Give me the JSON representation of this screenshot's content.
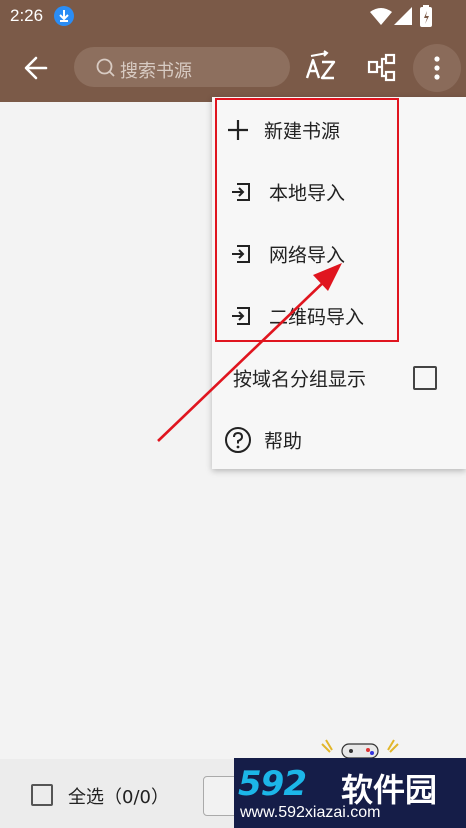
{
  "status_bar": {
    "time": "2:26"
  },
  "toolbar": {
    "search_placeholder": "搜索书源",
    "sort_label": "AZ"
  },
  "menu": {
    "items": [
      {
        "label": "新建书源",
        "icon": "plus-icon"
      },
      {
        "label": "本地导入",
        "icon": "import-icon"
      },
      {
        "label": "网络导入",
        "icon": "import-icon"
      },
      {
        "label": "二维码导入",
        "icon": "import-icon"
      },
      {
        "label": "按域名分组显示",
        "icon": "checkbox-icon",
        "checked": false
      },
      {
        "label": "帮助",
        "icon": "help-icon"
      }
    ]
  },
  "bottom_bar": {
    "select_all": "全选（0/0）"
  },
  "watermark": {
    "brand": "592软件园",
    "brand_number": "592",
    "brand_text": "软件园",
    "url": "www.592xiazai.com"
  },
  "colors": {
    "toolbar": "#7b5a48",
    "highlight": "#e0151f",
    "background": "#f3f3f3"
  }
}
